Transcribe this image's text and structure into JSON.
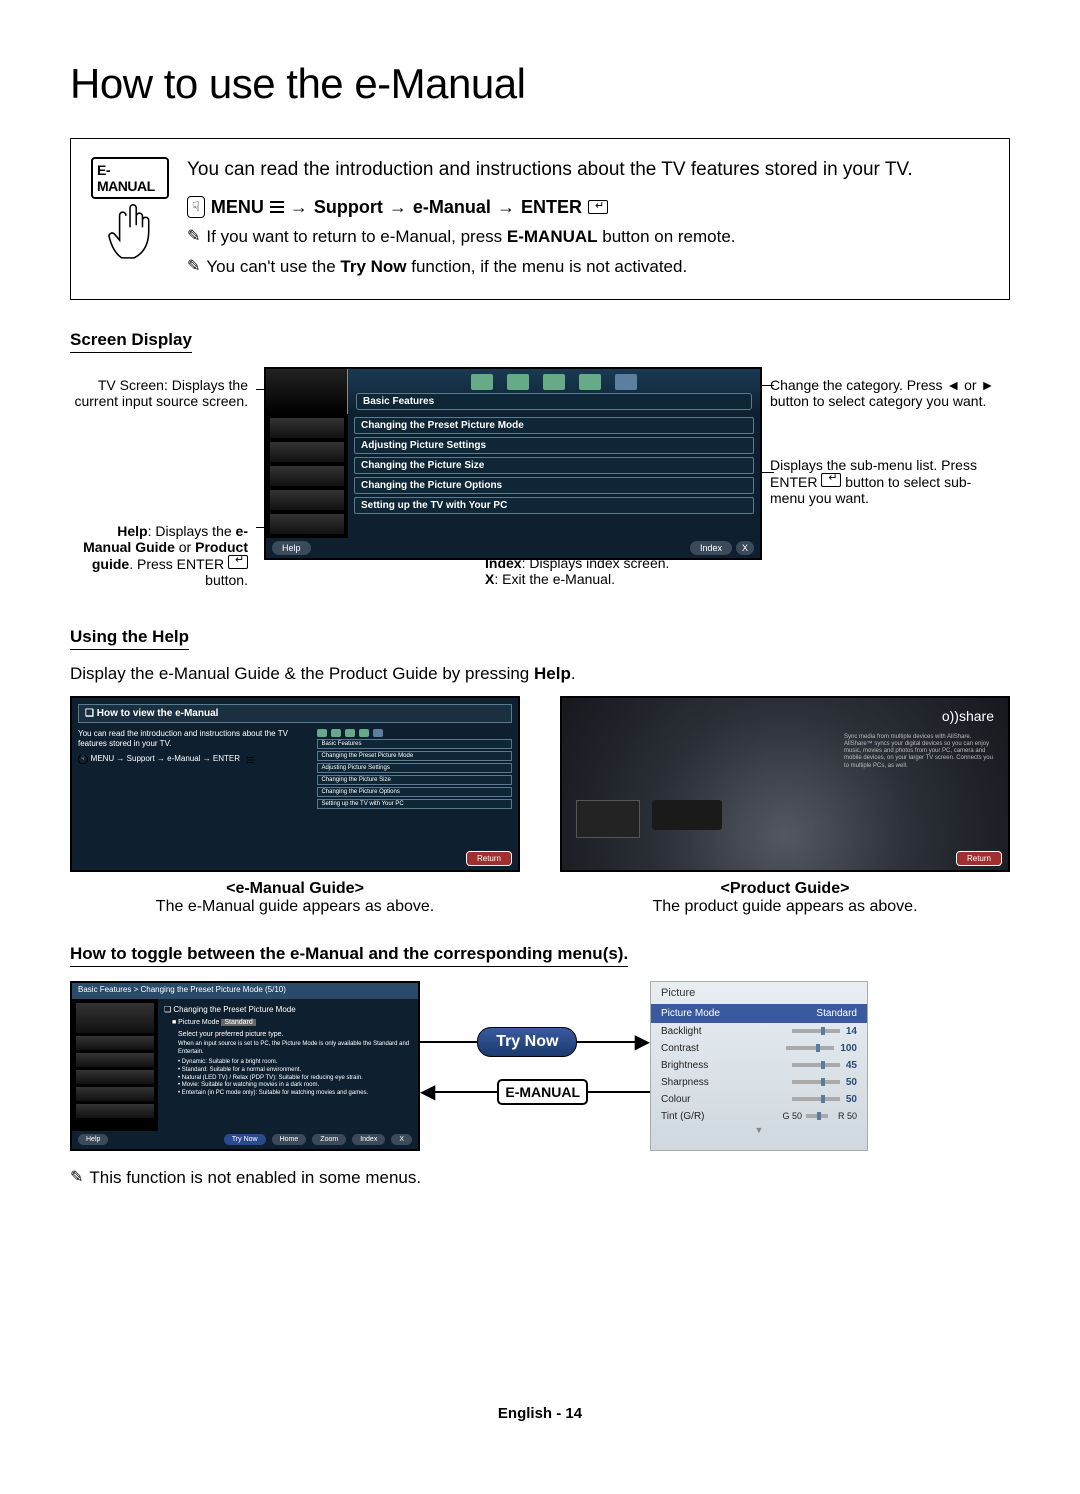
{
  "page_title": "How to use the e-Manual",
  "emanual_label": "E-MANUAL",
  "intro_text": "You can read the introduction and instructions about the TV features stored in your TV.",
  "menu_path": {
    "menu": "MENU",
    "arrow": " → ",
    "support": "Support",
    "emanual": "e-Manual",
    "enter": "ENTER"
  },
  "notes": {
    "n1_pre": "If you want to return to e-Manual, press ",
    "n1_bold": "E-MANUAL",
    "n1_post": " button on remote.",
    "n2_pre": "You can't use the ",
    "n2_bold": "Try Now",
    "n2_post": " function, if the menu is not activated."
  },
  "screen_display_heading": "Screen Display",
  "sd_category": "Basic Features",
  "sd_items": [
    "Changing the Preset Picture Mode",
    "Adjusting Picture Settings",
    "Changing the Picture Size",
    "Changing the Picture Options",
    "Setting up the TV with Your PC"
  ],
  "sd_help": "Help",
  "sd_index": "Index",
  "sd_x": "X",
  "callouts": {
    "tl": "TV Screen: Displays the current input source screen.",
    "bl_pre": "Help",
    "bl_mid": ": Displays the ",
    "bl_b1": "e-Manual Guide",
    "bl_or": " or ",
    "bl_b2": "Product guide",
    "bl_end": ". Press ENTER",
    "bl_end2": " button.",
    "tr": "Change the category. Press ◄ or ► button to select category you want.",
    "mr": "Displays the sub-menu list. Press ENTER",
    "mr2": " button to select sub-menu you want.",
    "br_b": "Index",
    "br_t": ": Displays index screen.",
    "br_b2": "X",
    "br_t2": ": Exit the e-Manual."
  },
  "using_help_heading": "Using the Help",
  "using_help_text_pre": "Display the e-Manual Guide & the Product Guide by pressing ",
  "using_help_text_b": "Help",
  "using_help_text_post": ".",
  "emg": {
    "title": "❏ How to view the e-Manual",
    "body": "You can read the introduction and instructions about the TV features stored in your TV.",
    "path": "MENU → Support → e-Manual → ENTER",
    "right_cat": "Basic Features",
    "right_items": [
      "Changing the Preset Picture Mode",
      "Adjusting Picture Settings",
      "Changing the Picture Size",
      "Changing the Picture Options",
      "Setting up the TV with Your PC"
    ],
    "return": "Return"
  },
  "pg": {
    "allshare": "o))share",
    "return": "Return",
    "blurb": "Sync media from multiple devices with AllShare. AllShare™ syncs your digital devices so you can enjoy music, movies and photos from your PC, camera and mobile devices, on your larger TV screen. Connects you to multiple PCs, as well."
  },
  "fig1_cap_b": "<e-Manual Guide>",
  "fig1_cap_t": "The e-Manual guide appears as above.",
  "fig2_cap_b": "<Product Guide>",
  "fig2_cap_t": "The product guide appears as above.",
  "toggle_heading": "How to toggle between the e-Manual and the corresponding menu(s).",
  "tg": {
    "breadcrumb": "Basic Features > Changing the Preset Picture Mode (5/10)",
    "subhead": "❏ Changing the Preset Picture Mode",
    "pm_label": "■ Picture Mode",
    "pm_val": "Standard",
    "desc": "Select your preferred picture type.",
    "note": "When an input source is set to PC, the Picture Mode is only available the Standard and Entertain.",
    "b1": "• Dynamic: Suitable for a bright room.",
    "b2": "• Standard: Suitable for a normal environment.",
    "b3": "• Natural (LED TV) / Relax (PDP TV): Suitable for reducing eye strain.",
    "b4": "• Movie: Suitable for watching movies in a dark room.",
    "b5": "• Entertain (in PC mode only): Suitable for watching movies and games.",
    "help": "Help",
    "trynow": "Try Now",
    "home": "Home",
    "zoom": "Zoom",
    "index": "Index",
    "x": "X"
  },
  "try_now_label": "Try Now",
  "emanual_pill_label": "E-MANUAL",
  "pic_menu": {
    "title": "Picture",
    "mode_l": "Picture Mode",
    "mode_v": "Standard",
    "backlight": "Backlight",
    "backlight_v": "14",
    "contrast": "Contrast",
    "contrast_v": "100",
    "brightness": "Brightness",
    "brightness_v": "45",
    "sharpness": "Sharpness",
    "sharpness_v": "50",
    "colour": "Colour",
    "colour_v": "50",
    "tint": "Tint (G/R)",
    "tint_g": "G 50",
    "tint_r": "R 50"
  },
  "final_note": "This function is not enabled in some menus.",
  "footer": "English - 14"
}
